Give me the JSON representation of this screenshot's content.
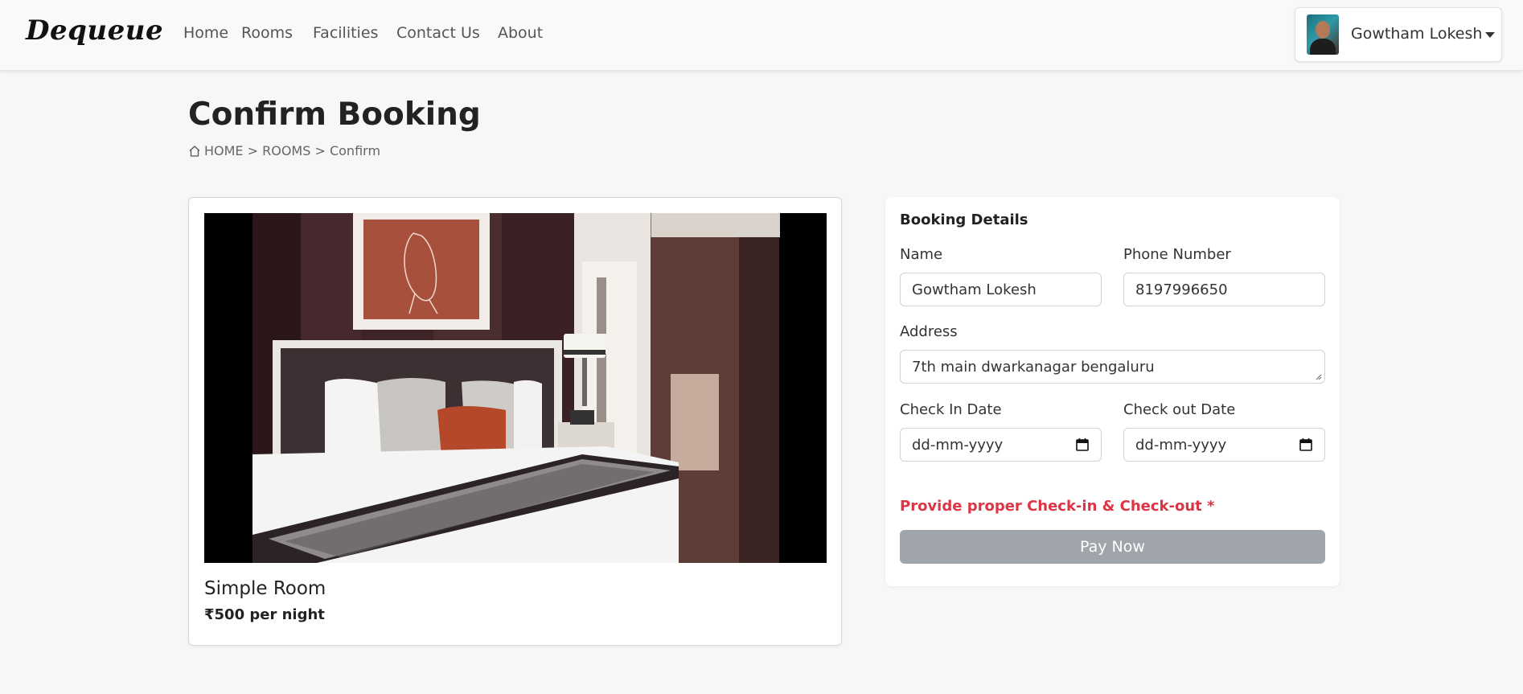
{
  "navbar": {
    "brand": "Dequeue",
    "links": [
      "Home",
      "Rooms",
      "Facilities",
      "Contact Us",
      "About"
    ],
    "user_name": "Gowtham Lokesh"
  },
  "header": {
    "title": "Confirm Booking",
    "breadcrumb": {
      "home": "HOME",
      "separator_1": " > ",
      "rooms": "ROOMS",
      "separator_2": " > ",
      "current": "Confirm"
    }
  },
  "room": {
    "name": "Simple Room",
    "price": "₹500 per night"
  },
  "booking": {
    "title": "Booking Details",
    "name_label": "Name",
    "name_value": "Gowtham Lokesh",
    "phone_label": "Phone Number",
    "phone_value": "8197996650",
    "address_label": "Address",
    "address_value": "7th main dwarkanagar bengaluru",
    "checkin_label": "Check In Date",
    "checkin_placeholder": "dd-mm-yyyy",
    "checkout_label": "Check out Date",
    "checkout_placeholder": "dd-mm-yyyy",
    "error": "Provide proper Check-in & Check-out *",
    "pay_button": "Pay Now"
  },
  "colors": {
    "error": "#dc3545",
    "pay_button_disabled": "#a0a4ab",
    "background": "#f6f7f9"
  }
}
